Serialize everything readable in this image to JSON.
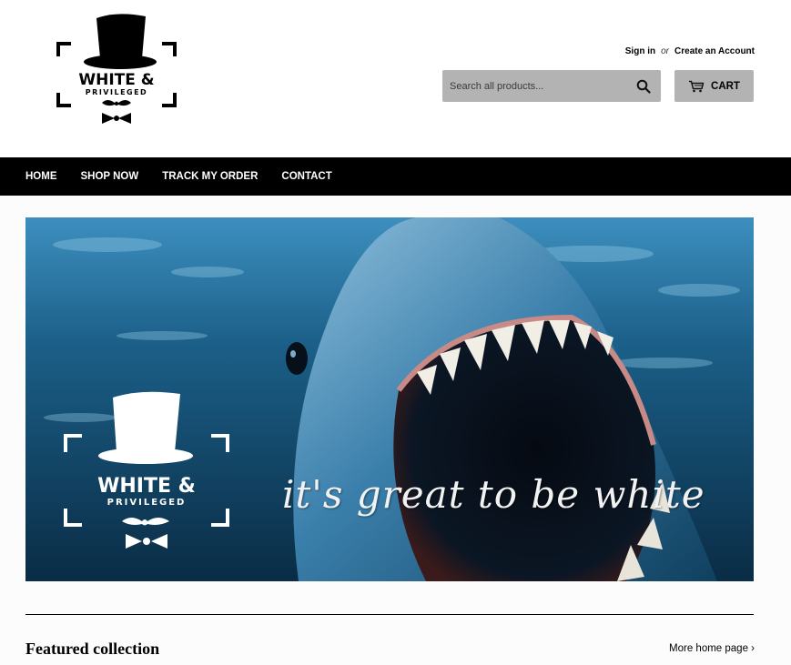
{
  "logo": {
    "line1": "WHITE &",
    "line2": "PRIVILEGED"
  },
  "account": {
    "sign_in": "Sign in",
    "or": "or",
    "create": "Create an Account"
  },
  "search": {
    "placeholder": "Search all products..."
  },
  "cart": {
    "label": "CART"
  },
  "nav": {
    "items": [
      "HOME",
      "SHOP NOW",
      "TRACK MY ORDER",
      "CONTACT"
    ]
  },
  "hero": {
    "tagline": "it's great to be white",
    "logo_line1": "WHITE &",
    "logo_line2": "PRIVILEGED"
  },
  "featured": {
    "title": "Featured collection",
    "more_link": "More home page ›"
  },
  "colors": {
    "nav_bg": "#000000",
    "button_bg": "#b3b3b3",
    "ocean": "#1e5a80"
  }
}
